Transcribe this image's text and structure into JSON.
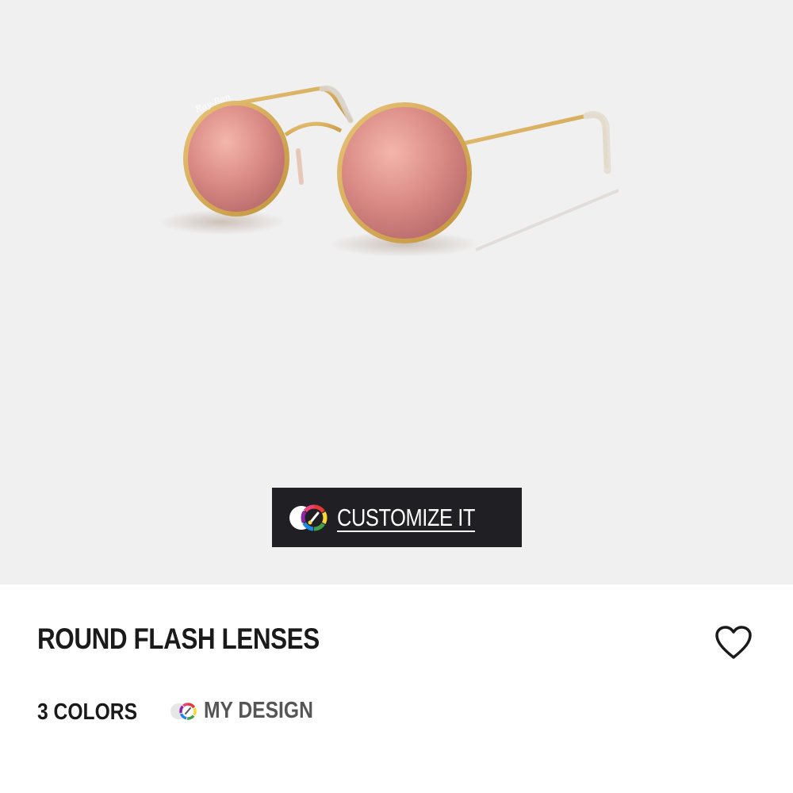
{
  "product": {
    "title": "ROUND FLASH LENSES",
    "image_alt": "Ray-Ban round sunglasses with gold frame and pink flash lenses",
    "brand_mark": "Ray-Ban"
  },
  "customize": {
    "label": "CUSTOMIZE IT",
    "icon": "color-wheel-icon"
  },
  "favorite": {
    "icon": "heart-outline-icon"
  },
  "variants": {
    "colors_label": "3 COLORS",
    "my_design_label": "MY DESIGN",
    "my_design_icon": "color-wheel-icon"
  },
  "colors": {
    "hero_bg": "#f0f0f0",
    "button_bg": "#1f1f24",
    "frame_gold": "#d4a94e",
    "lens_pink": "#d98a84",
    "text_dark": "#1a1a1a",
    "text_muted": "#555555"
  }
}
